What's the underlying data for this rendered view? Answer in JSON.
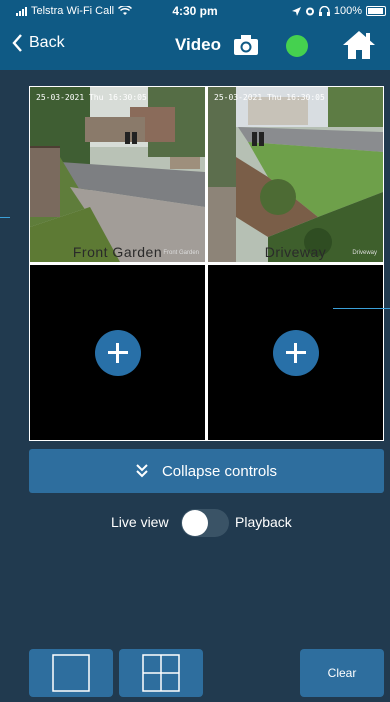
{
  "status_bar": {
    "carrier": "Telstra Wi-Fi Call",
    "time": "4:30 pm",
    "battery": "100%"
  },
  "nav": {
    "back_label": "Back",
    "title": "Video",
    "status_color": "#45d14f",
    "bar_color": "#0f5a85"
  },
  "cameras": [
    {
      "label": "Front Garden",
      "timestamp": "25-03-2021 Thu 16:30:05",
      "watermark": "Front Garden"
    },
    {
      "label": "Driveway",
      "timestamp": "25-03-2021 Thu 16:30:05",
      "watermark": "Driveway"
    }
  ],
  "empty_slots": [
    {
      "icon": "plus-icon"
    },
    {
      "icon": "plus-icon"
    }
  ],
  "controls": {
    "collapse_label": "Collapse controls",
    "live_label": "Live view",
    "playback_label": "Playback",
    "playback_enabled": false
  },
  "toolbar": {
    "single_icon": "single-layout-icon",
    "quad_icon": "quad-layout-icon",
    "clear_label": "Clear"
  },
  "colors": {
    "background": "#213a4f",
    "accent": "#2e6e9e",
    "selected_border": "#4bb54b"
  }
}
